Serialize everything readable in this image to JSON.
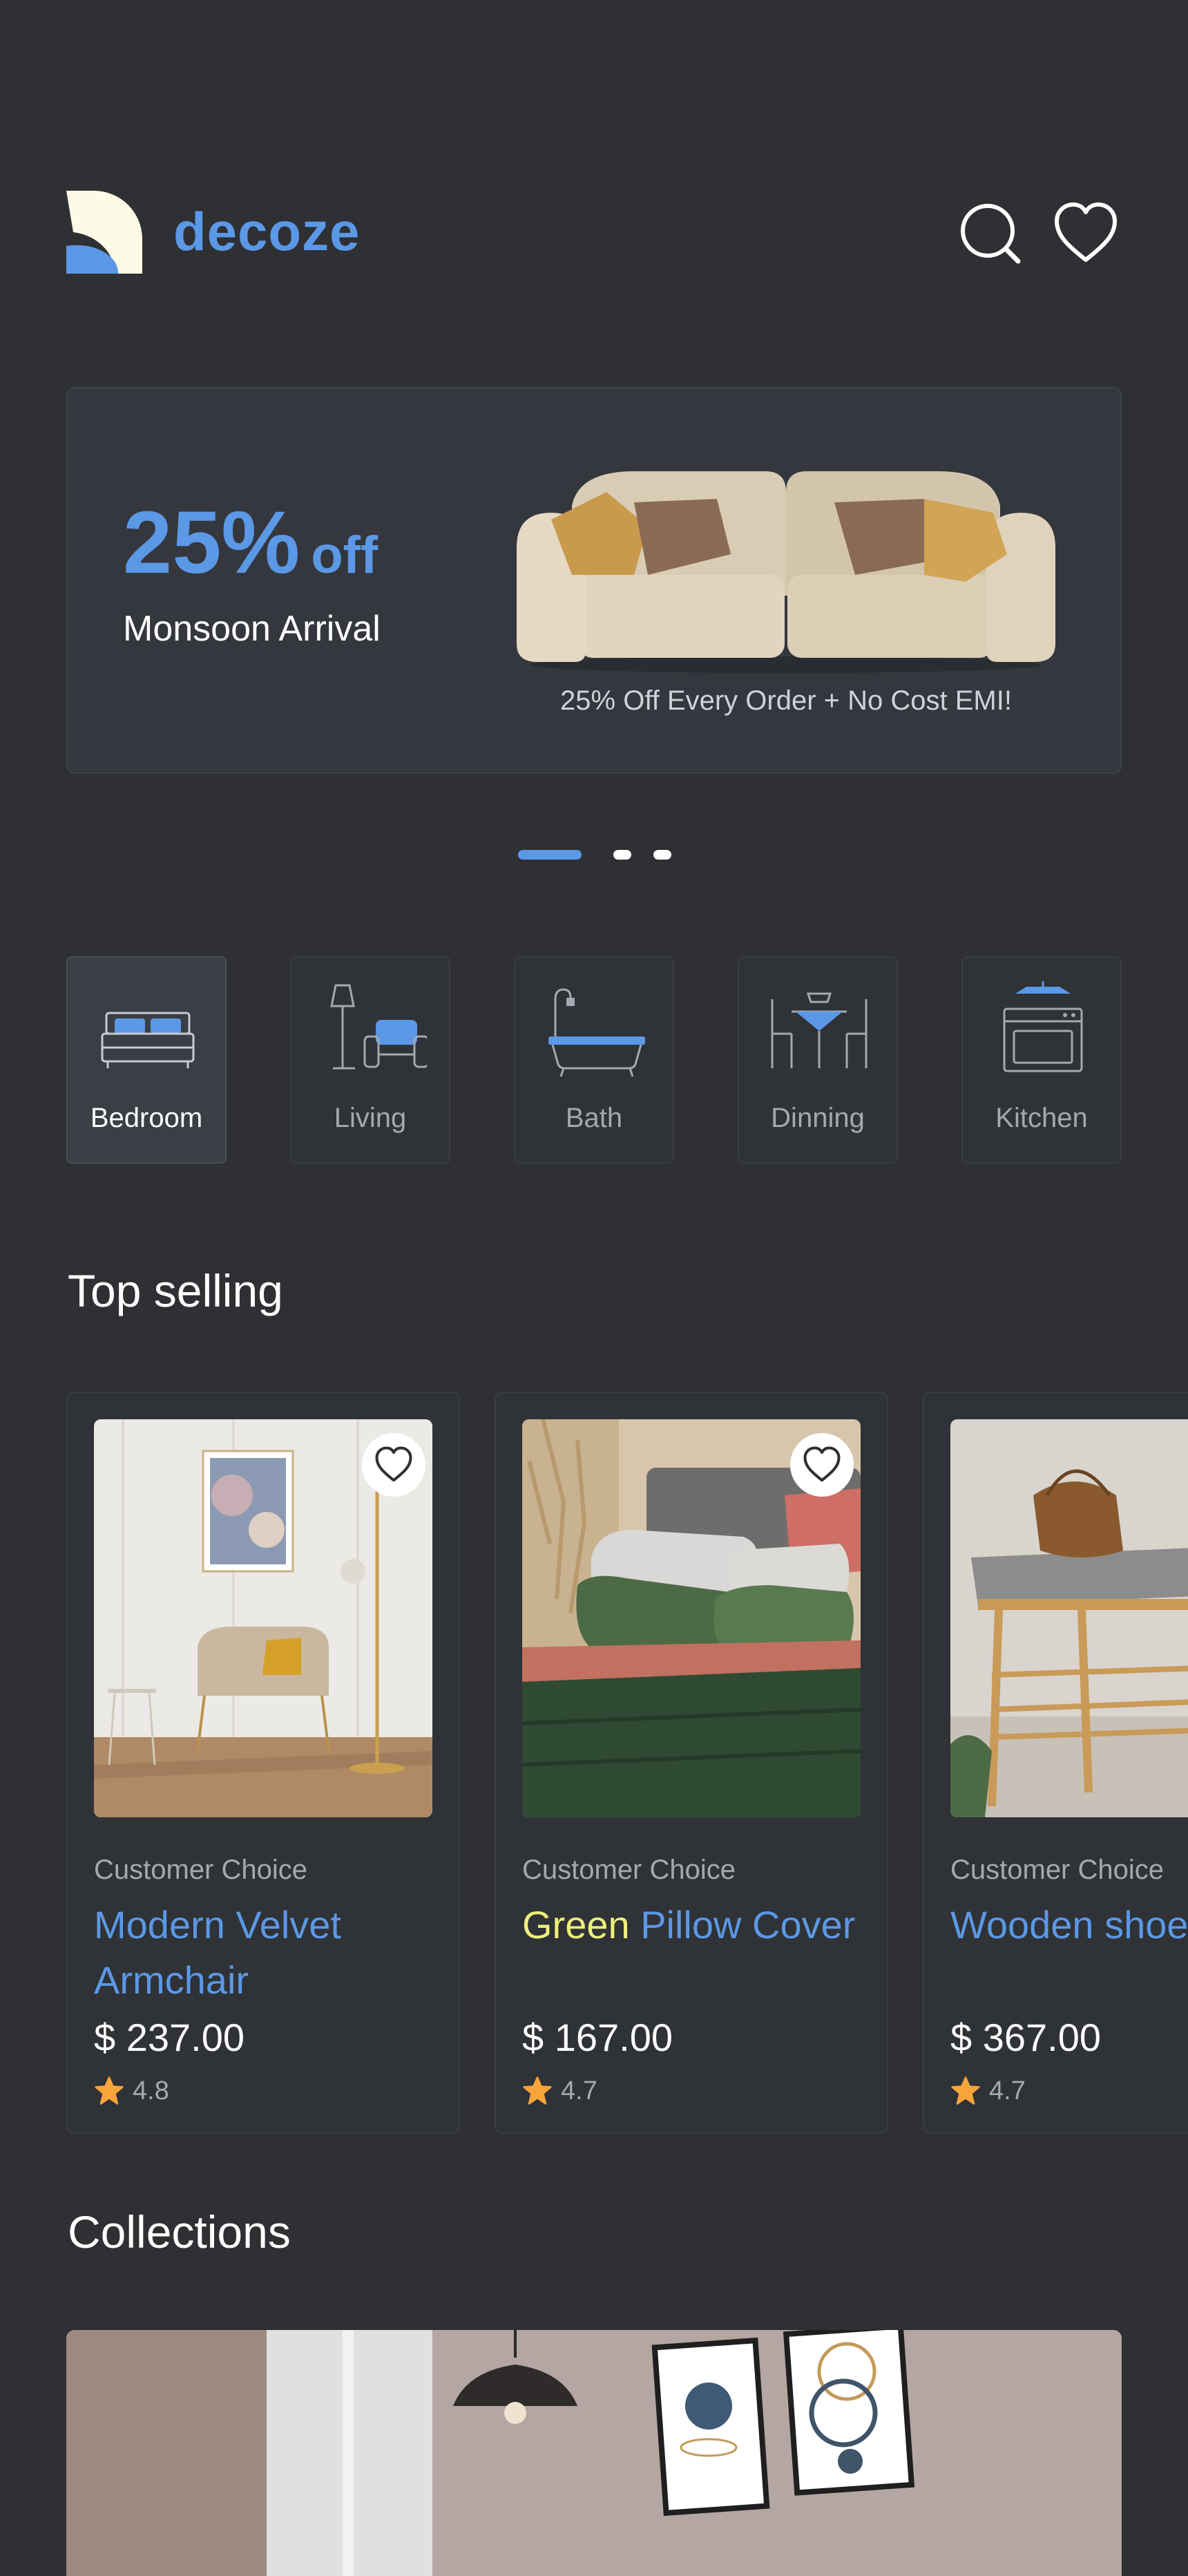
{
  "brand": {
    "name": "decoze",
    "accent": "#5b98e6",
    "logo_icon": "decoze-logo-icon"
  },
  "header": {
    "search_icon": "search-icon",
    "favorites_icon": "heart-icon"
  },
  "banner": {
    "discount": "25%",
    "discount_suffix": "off",
    "title": "Monsoon Arrival",
    "caption": "25% Off Every Order + No Cost EMI!"
  },
  "carousel": {
    "pages": 3,
    "active_index": 0
  },
  "categories": [
    {
      "label": "Bedroom",
      "icon": "bed-icon",
      "active": true
    },
    {
      "label": "Living",
      "icon": "armchair-lamp-icon",
      "active": false
    },
    {
      "label": "Bath",
      "icon": "bathtub-icon",
      "active": false
    },
    {
      "label": "Dinning",
      "icon": "dining-table-icon",
      "active": false
    },
    {
      "label": "Kitchen",
      "icon": "oven-icon",
      "active": false
    }
  ],
  "top_selling": {
    "title": "Top selling",
    "products": [
      {
        "eyebrow": "Customer Choice",
        "name": "Modern Velvet Armchair",
        "name_highlight": "",
        "name_rest": "Modern Velvet Armchair",
        "price": "$ 237.00",
        "rating": "4.8"
      },
      {
        "eyebrow": "Customer Choice",
        "name": "Green Pillow Cover",
        "name_highlight": "Green",
        "name_rest": " Pillow Cover",
        "price": "$ 167.00",
        "rating": "4.7"
      },
      {
        "eyebrow": "Customer Choice",
        "name": "Wooden shoe Rack",
        "name_highlight": "",
        "name_rest": "Wooden shoe Rack",
        "price": "$ 367.00",
        "rating": "4.7"
      }
    ]
  },
  "collections": {
    "title": "Collections"
  }
}
